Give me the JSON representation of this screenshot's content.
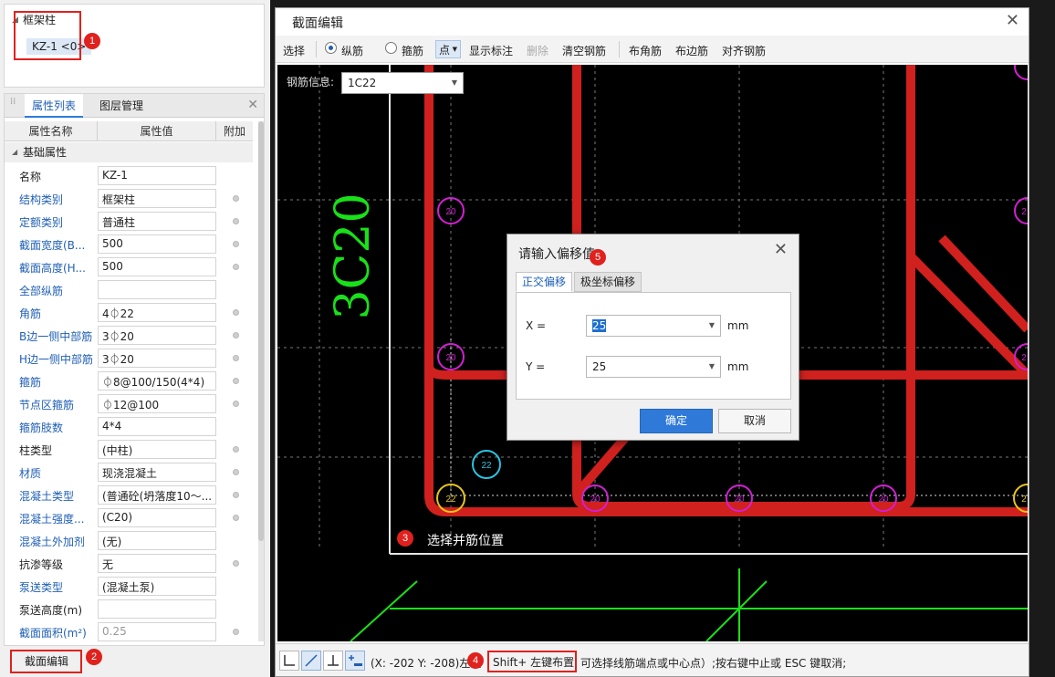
{
  "tree": {
    "root_label": "框架柱",
    "selected_node": "KZ-1 <0>"
  },
  "badges": [
    "1",
    "2",
    "3",
    "4",
    "5"
  ],
  "props_panel": {
    "tab_active": "属性列表",
    "tab_other": "图层管理",
    "col_name": "属性名称",
    "col_value": "属性值",
    "col_extra": "附加",
    "group": "基础属性",
    "rows": [
      {
        "name": "名称",
        "value": "KZ-1"
      },
      {
        "name": "结构类别",
        "value": "框架柱"
      },
      {
        "name": "定额类别",
        "value": "普通柱"
      },
      {
        "name": "截面宽度(B...",
        "value": "500"
      },
      {
        "name": "截面高度(H...",
        "value": "500"
      },
      {
        "name": "全部纵筋",
        "value": ""
      },
      {
        "name": "角筋",
        "value": "4⏀22"
      },
      {
        "name": "B边一侧中部筋",
        "value": "3⏀20"
      },
      {
        "name": "H边一侧中部筋",
        "value": "3⏀20"
      },
      {
        "name": "箍筋",
        "value": "⏀8@100/150(4*4)"
      },
      {
        "name": "节点区箍筋",
        "value": "⏀12@100"
      },
      {
        "name": "箍筋肢数",
        "value": "4*4"
      },
      {
        "name": "柱类型",
        "value": "(中柱)"
      },
      {
        "name": "材质",
        "value": "现浇混凝土"
      },
      {
        "name": "混凝土类型",
        "value": "(普通砼(坍落度10～..."
      },
      {
        "name": "混凝土强度...",
        "value": "(C20)"
      },
      {
        "name": "混凝土外加剂",
        "value": "(无)"
      },
      {
        "name": "抗渗等级",
        "value": "无"
      },
      {
        "name": "泵送类型",
        "value": "(混凝土泵)"
      },
      {
        "name": "泵送高度(m)",
        "value": ""
      },
      {
        "name": "截面面积(m²)",
        "value": "0.25"
      }
    ],
    "bottom_button": "截面编辑"
  },
  "dialog": {
    "title": "截面编辑",
    "toolbar": {
      "select": "选择",
      "longitudinal": "纵筋",
      "stirrup": "箍筋",
      "point": "点",
      "show_label": "显示标注",
      "delete": "删除",
      "clear": "清空钢筋",
      "corner": "布角筋",
      "edge": "布边筋",
      "align": "对齐钢筋"
    },
    "rebar_info_label": "钢筋信息:",
    "rebar_info_value": "1C22",
    "canvas": {
      "big_label": "3C20",
      "hint": "选择并筋位置",
      "circle_labels": {
        "top_left_20": "20",
        "left_mid_20": "20",
        "corner_22": "22",
        "cyan_22": "22",
        "bottom_1": "20",
        "bottom_2": "20",
        "bottom_3": "20",
        "right_a": "2",
        "right_b": "2",
        "right_c": "2"
      }
    },
    "status": {
      "coords": "(X: -202 Y: -208)左键",
      "shift": "Shift+ 左键布置",
      "rest": "可选择线筋端点或中心点）;按右键中止或 ESC 键取消;"
    }
  },
  "offset_dialog": {
    "title": "请输入偏移值",
    "tab_ortho": "正交偏移",
    "tab_polar": "极坐标偏移",
    "x_label": "X =",
    "x_value": "25",
    "x_unit": "mm",
    "y_label": "Y =",
    "y_value": "25",
    "y_unit": "mm",
    "ok": "确定",
    "cancel": "取消"
  },
  "colors": {
    "rebar_red": "#d0211f",
    "magenta": "#d21fd2",
    "yellow": "#e8c21a",
    "cyan": "#29c3e0",
    "green": "#19e019",
    "accent": "#2f7ad9"
  }
}
